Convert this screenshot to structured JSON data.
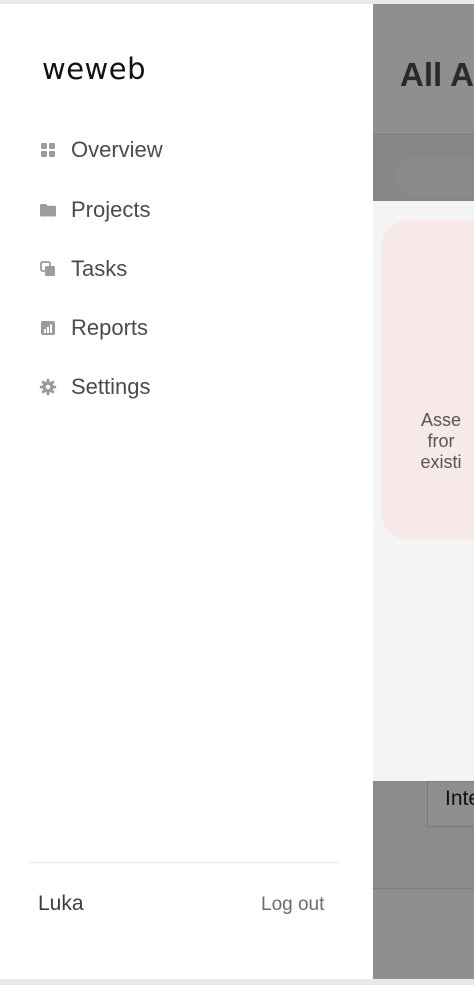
{
  "sidebar": {
    "logo": "weweb",
    "items": [
      {
        "label": "Overview",
        "icon": "grid-icon"
      },
      {
        "label": "Projects",
        "icon": "folder-icon"
      },
      {
        "label": "Tasks",
        "icon": "copy-icon"
      },
      {
        "label": "Reports",
        "icon": "bar-chart-icon"
      },
      {
        "label": "Settings",
        "icon": "gear-icon"
      }
    ],
    "user": "Luka",
    "logout_label": "Log out"
  },
  "background": {
    "title": "All A",
    "card_lines": [
      "Asse",
      "fror",
      "existi"
    ],
    "lower_text": "Inte"
  },
  "colors": {
    "icon": "#9b9ba3",
    "label": "#4a4a52",
    "overlay": "#8f8f8f",
    "card": "#f7e9e8"
  }
}
